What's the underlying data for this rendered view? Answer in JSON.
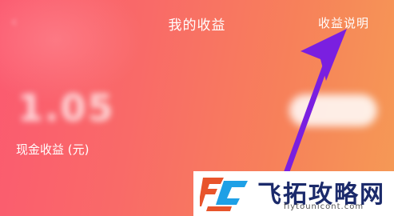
{
  "header": {
    "title": "我的收益",
    "explain_link": "收益说明",
    "back_icon": "chevron-left-icon"
  },
  "earnings": {
    "amount": "1.05",
    "cash_label": "现金收益 (元)"
  },
  "annotation": {
    "arrow_color": "#7a1fe0",
    "arrow_icon": "arrow-pointer-icon"
  },
  "watermark": {
    "logo_colors": [
      "#e8542b",
      "#1ea0e6"
    ],
    "title": "飞拓攻略网",
    "url": "fiytounicont.com"
  }
}
